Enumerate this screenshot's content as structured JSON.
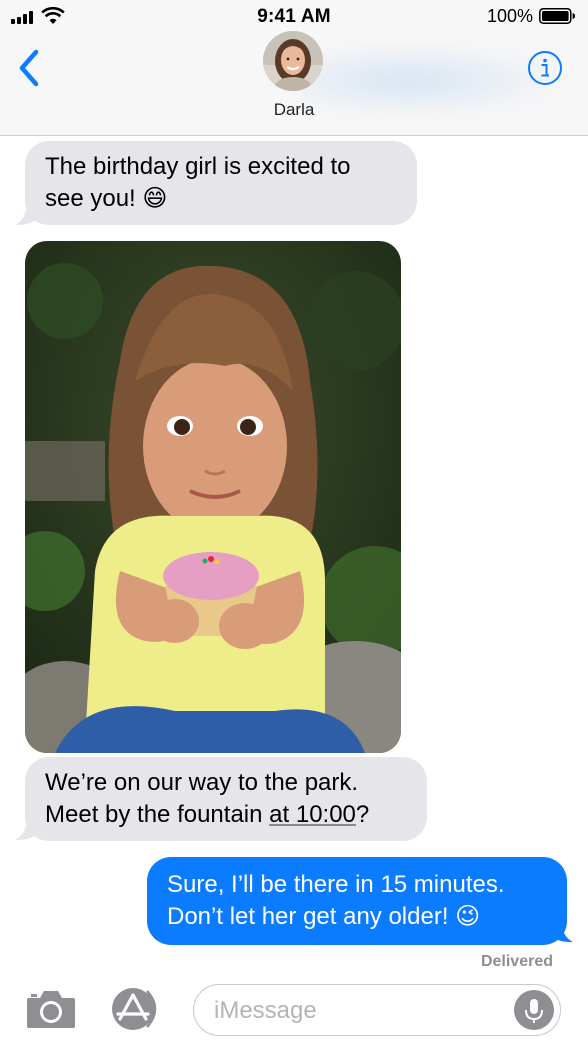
{
  "status_bar": {
    "time": "9:41 AM",
    "battery": "100%"
  },
  "header": {
    "contact_name": "Darla"
  },
  "messages": [
    {
      "direction": "incoming",
      "lines": [
        "The birthday girl is excited to",
        "see you! 😄"
      ]
    },
    {
      "direction": "incoming",
      "type": "photo"
    },
    {
      "direction": "incoming",
      "line1": "We’re on our way to the park.",
      "line2_pre": "Meet by the fountain ",
      "line2_link": "at 10:00",
      "line2_post": "?"
    },
    {
      "direction": "outgoing",
      "lines": [
        "Sure, I’ll be there in 15 minutes.",
        "Don’t let her get any older! 😉"
      ]
    }
  ],
  "delivered_label": "Delivered",
  "input": {
    "placeholder": "iMessage"
  },
  "colors": {
    "accent": "#0b7cff",
    "incoming_bubble": "#e5e5ea",
    "outgoing_bubble": "#0b7cff"
  },
  "icons": [
    "signal-icon",
    "wifi-icon",
    "battery-icon",
    "back-chevron-icon",
    "info-icon",
    "camera-icon",
    "app-store-icon",
    "microphone-icon"
  ]
}
